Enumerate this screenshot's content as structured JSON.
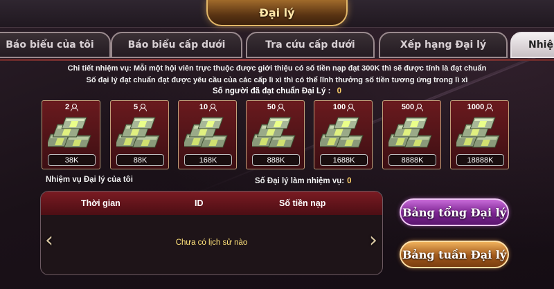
{
  "header": {
    "title": "Đại lý"
  },
  "tabs": [
    {
      "label": "Báo biểu của tôi"
    },
    {
      "label": "Báo biểu cấp dưới"
    },
    {
      "label": "Tra cứu cấp dưới"
    },
    {
      "label": "Xếp hạng Đại lý"
    },
    {
      "label": "Nhiệ"
    }
  ],
  "mission": {
    "detail": "Chi tiết nhiệm vụ: Mỗi một hội viên trực thuộc được giới thiệu có số tiền nạp đạt 300K thì sẽ được tính là đạt chuẩn",
    "rule": "Số đại lý đạt chuẩn đạt được yêu cầu của các cấp lì xì thì có thể lĩnh thưởng số tiền tương ứng trong lì xì",
    "qualified_label": "Số người đã đạt chuẩn Đại Lý :",
    "qualified_value": "0"
  },
  "rewards": [
    {
      "count": "2",
      "amount": "38K"
    },
    {
      "count": "5",
      "amount": "88K"
    },
    {
      "count": "10",
      "amount": "168K"
    },
    {
      "count": "50",
      "amount": "888K"
    },
    {
      "count": "100",
      "amount": "1688K"
    },
    {
      "count": "500",
      "amount": "8888K"
    },
    {
      "count": "1000",
      "amount": "18888K"
    }
  ],
  "labels": {
    "my_mission": "Nhiệm vụ Đại lý của tôi",
    "agents_on_mission": "Số Đại lý làm nhiệm vụ:",
    "agents_on_mission_value": "0"
  },
  "history": {
    "columns": [
      "Thời gian",
      "ID",
      "Số tiền nạp"
    ],
    "empty_text": "Chưa có lịch sử nào"
  },
  "buttons": {
    "total_board": "Bảng tổng Đại lý",
    "weekly_board": "Bảng tuần Đại lý"
  },
  "colors": {
    "accent_gold": "#ffd36b",
    "card_red": "#6a1a1e",
    "button_purple": "#7a2390",
    "button_gold": "#a0581b"
  }
}
